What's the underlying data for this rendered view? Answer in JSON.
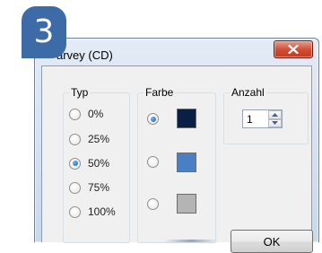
{
  "step_badge": {
    "number": "3",
    "color": "#3d6ba7"
  },
  "window": {
    "title": "arvey (CD)",
    "close_icon": "close-x-icon"
  },
  "groups": {
    "typ": {
      "label": "Typ",
      "options": [
        {
          "label": "0%",
          "selected": false
        },
        {
          "label": "25%",
          "selected": false
        },
        {
          "label": "50%",
          "selected": true
        },
        {
          "label": "75%",
          "selected": false
        },
        {
          "label": "100%",
          "selected": false
        }
      ]
    },
    "farbe": {
      "label": "Farbe",
      "options": [
        {
          "color": "#0a1f44",
          "selected": true
        },
        {
          "color": "#4a7fc4",
          "selected": false
        },
        {
          "color": "#b4b4b4",
          "selected": false
        }
      ]
    },
    "anzahl": {
      "label": "Anzahl",
      "value": "1"
    }
  },
  "buttons": {
    "ok_label": "OK"
  }
}
